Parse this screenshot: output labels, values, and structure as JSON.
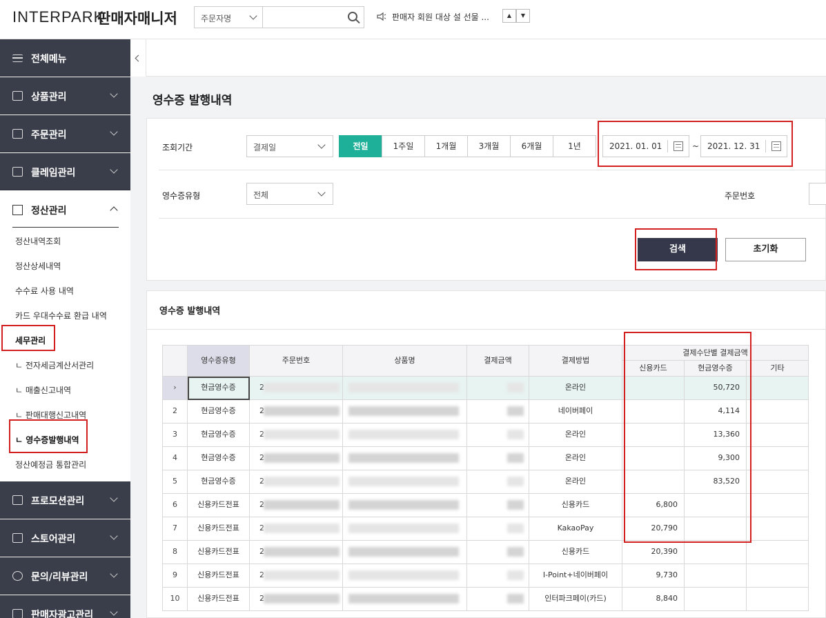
{
  "topbar": {
    "logo_en": "INTERPARK",
    "logo_ko": "판매자매니저",
    "search_select": "주문자명",
    "notice": "판매자 회원 대상 설 선물 ...",
    "notice_up": "▲",
    "notice_down": "▼"
  },
  "sidebar": {
    "all_menu": "전체메뉴",
    "menus": [
      "상품관리",
      "주문관리",
      "클레임관리"
    ],
    "settlement": "정산관리",
    "sub_items": [
      "정산내역조회",
      "정산상세내역",
      "수수료 사용 내역",
      "카드 우대수수료 환급 내역",
      "세무관리",
      "ㄴ 전자세금계산서관리",
      "ㄴ 매출신고내역",
      "ㄴ 판매대행신고내역",
      "ㄴ 영수증발행내역",
      "정산예정금 통합관리"
    ],
    "bottom_menus": [
      "프로모션관리",
      "스토어관리",
      "문의/리뷰관리",
      "판매자광고관리"
    ]
  },
  "page": {
    "title": "영수증 발행내역"
  },
  "filter": {
    "period_label": "조회기간",
    "date_type": "결제일",
    "periods": [
      "전일",
      "1주일",
      "1개월",
      "3개월",
      "6개월",
      "1년"
    ],
    "active_period": "전일",
    "date_from": "2021. 01. 01",
    "date_to": "2021. 12. 31",
    "tilde": "~",
    "receipt_type_label": "영수증유형",
    "receipt_type": "전체",
    "order_no_label": "주문번호",
    "search_button": "검색",
    "reset_button": "초기화"
  },
  "results": {
    "title": "영수증 발행내역",
    "headers": {
      "receipt_type": "영수증유형",
      "order_no": "주문번호",
      "product": "상품명",
      "amount": "결제금액",
      "method": "결제방법",
      "group": "결제수단별 결제금액",
      "credit": "신용카드",
      "cash": "현금영수증",
      "other": "기타"
    },
    "rows": [
      {
        "num": "›",
        "type": "현금영수증",
        "order": "2",
        "method": "온라인",
        "credit": "",
        "cash": "50,720"
      },
      {
        "num": "2",
        "type": "현금영수증",
        "order": "2",
        "method": "네이버페이",
        "credit": "",
        "cash": "4,114"
      },
      {
        "num": "3",
        "type": "현금영수증",
        "order": "2",
        "method": "온라인",
        "credit": "",
        "cash": "13,360"
      },
      {
        "num": "4",
        "type": "현금영수증",
        "order": "2",
        "method": "온라인",
        "credit": "",
        "cash": "9,300"
      },
      {
        "num": "5",
        "type": "현금영수증",
        "order": "2",
        "method": "온라인",
        "credit": "",
        "cash": "83,520"
      },
      {
        "num": "6",
        "type": "신용카드전표",
        "order": "2",
        "method": "신용카드",
        "credit": "6,800",
        "cash": ""
      },
      {
        "num": "7",
        "type": "신용카드전표",
        "order": "2",
        "method": "KakaoPay",
        "credit": "20,790",
        "cash": ""
      },
      {
        "num": "8",
        "type": "신용카드전표",
        "order": "2",
        "method": "신용카드",
        "credit": "20,390",
        "cash": ""
      },
      {
        "num": "9",
        "type": "신용카드전표",
        "order": "2",
        "method": "I-Point+네이버페이",
        "credit": "9,730",
        "cash": ""
      },
      {
        "num": "10",
        "type": "신용카드전표",
        "order": "2",
        "method": "인터파크페이(카드)",
        "credit": "8,840",
        "cash": ""
      }
    ]
  },
  "colors": {
    "sidebar_dark": "#3a3d4a",
    "accent_teal": "#1fb09a",
    "highlight_red": "#d21f1f",
    "search_button": "#34384a"
  }
}
